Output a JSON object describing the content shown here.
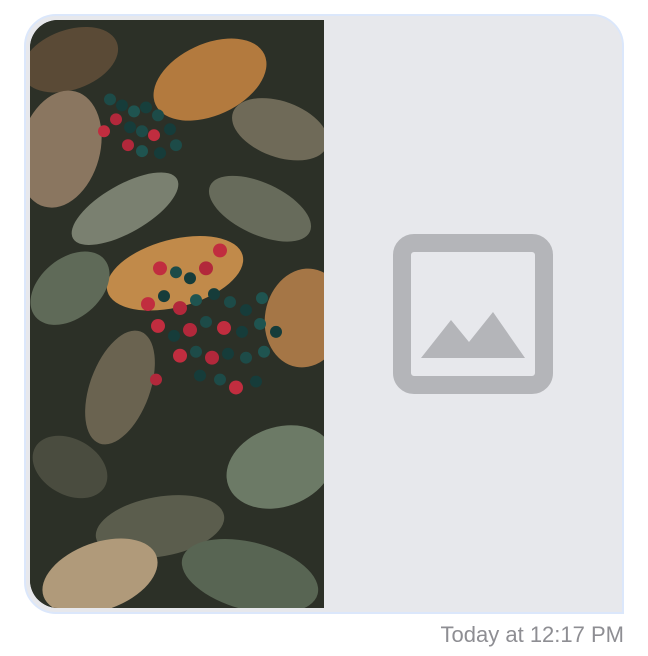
{
  "message": {
    "images": [
      {
        "kind": "photo",
        "icon": "berries-foliage-photo"
      },
      {
        "kind": "placeholder",
        "icon": "image-placeholder-icon"
      }
    ],
    "timestamp": "Today at 12:17 PM"
  },
  "colors": {
    "bubble_border": "#dbe7fb",
    "placeholder_bg": "#e7e8ec",
    "placeholder_icon": "#b4b5b9",
    "timestamp": "#8e8e93"
  }
}
